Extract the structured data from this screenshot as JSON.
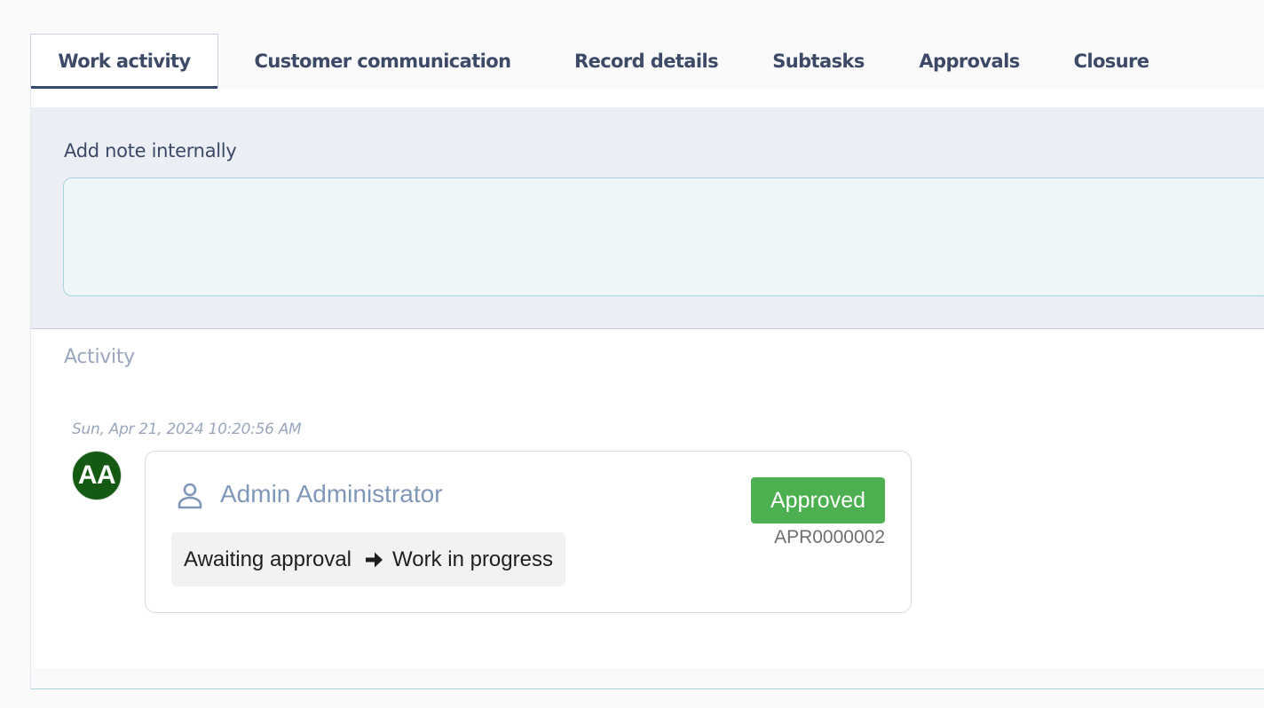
{
  "tabs": [
    {
      "label": "Work activity",
      "active": true
    },
    {
      "label": "Customer communication",
      "active": false
    },
    {
      "label": "Record details",
      "active": false
    },
    {
      "label": "Subtasks",
      "active": false
    },
    {
      "label": "Approvals",
      "active": false
    },
    {
      "label": "Closure",
      "active": false
    }
  ],
  "note": {
    "label": "Add note internally",
    "value": "",
    "placeholder": ""
  },
  "activity": {
    "title": "Activity",
    "entries": [
      {
        "timestamp": "Sun, Apr 21, 2024 10:20:56 AM",
        "avatar_initials": "AA",
        "avatar_color": "#155a12",
        "user_icon": "person-outline-icon",
        "user_name": "Admin Administrator",
        "status_from": "Awaiting approval",
        "arrow_icon": "arrow-right-icon",
        "status_to": "Work in progress",
        "badge": "Approved",
        "badge_color": "#4caf50",
        "record_id": "APR0000002"
      }
    ]
  },
  "colors": {
    "tab_text": "#3c4a68",
    "active_tab_underline": "#34486b",
    "note_section_bg": "#eceef6",
    "note_input_bg": "#eff6f8",
    "user_name": "#8097b8"
  }
}
